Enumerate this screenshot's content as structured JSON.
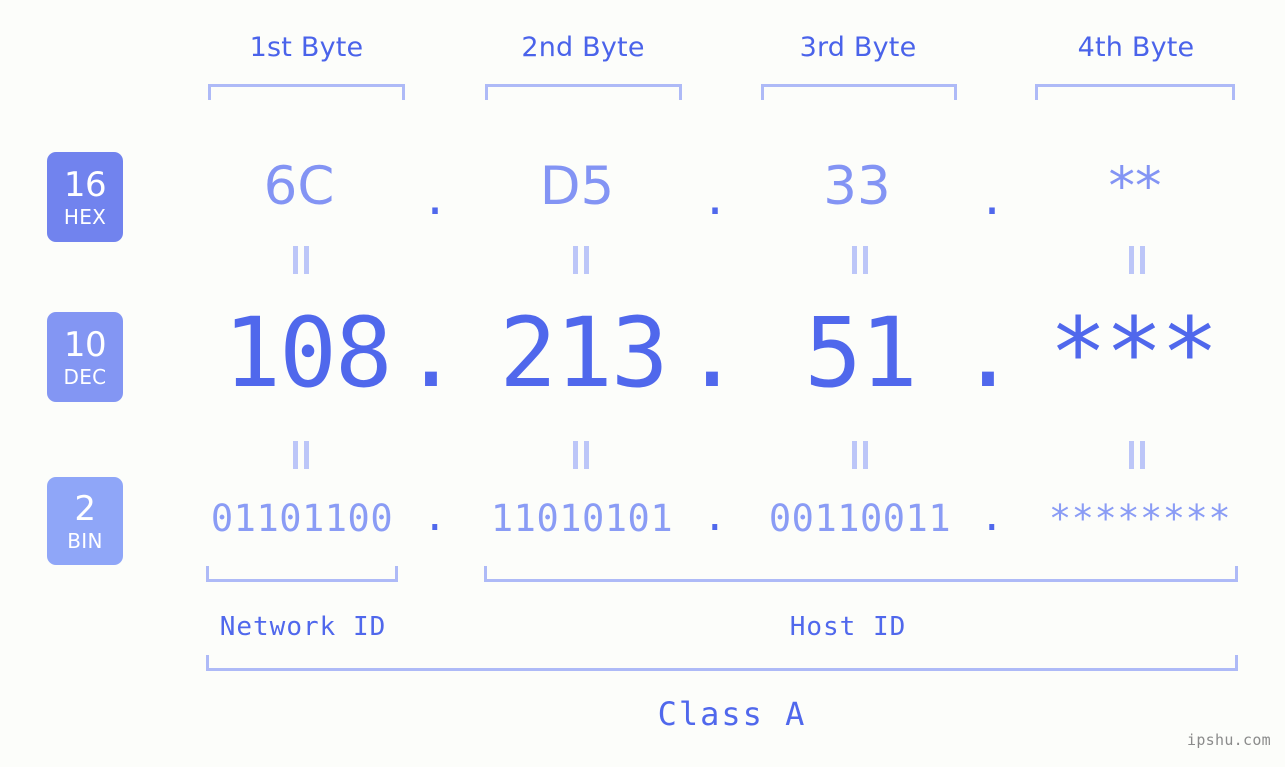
{
  "background_color": "#fcfdfa",
  "accent_color": "#5068ec",
  "accent_light": "#8a9cf5",
  "bracket_color": "#aebaf7",
  "byte_headers": [
    {
      "label": "1st Byte"
    },
    {
      "label": "2nd Byte"
    },
    {
      "label": "3rd Byte"
    },
    {
      "label": "4th Byte"
    }
  ],
  "radix_badges": [
    {
      "number": "16",
      "unit": "HEX",
      "color": "#7183ee"
    },
    {
      "number": "10",
      "unit": "DEC",
      "color": "#8396f3"
    },
    {
      "number": "2",
      "unit": "BIN",
      "color": "#8fa6f8"
    }
  ],
  "rows": {
    "hex": {
      "radix": "16",
      "name": "HEX",
      "values": [
        "6C",
        "D5",
        "33",
        "**"
      ],
      "separators": [
        ".",
        ".",
        "."
      ]
    },
    "dec": {
      "radix": "10",
      "name": "DEC",
      "values": [
        "108",
        "213",
        "51",
        "***"
      ],
      "separators": [
        ".",
        ".",
        "."
      ]
    },
    "bin": {
      "radix": "2",
      "name": "BIN",
      "values": [
        "01101100",
        "11010101",
        "00110011",
        "********"
      ],
      "separators": [
        ".",
        ".",
        "."
      ]
    }
  },
  "equals_marks": {
    "glyph": "||",
    "count_per_row": 4
  },
  "sections": {
    "network_id": "Network ID",
    "host_id": "Host ID",
    "class": "Class A"
  },
  "watermark": "ipshu.com"
}
